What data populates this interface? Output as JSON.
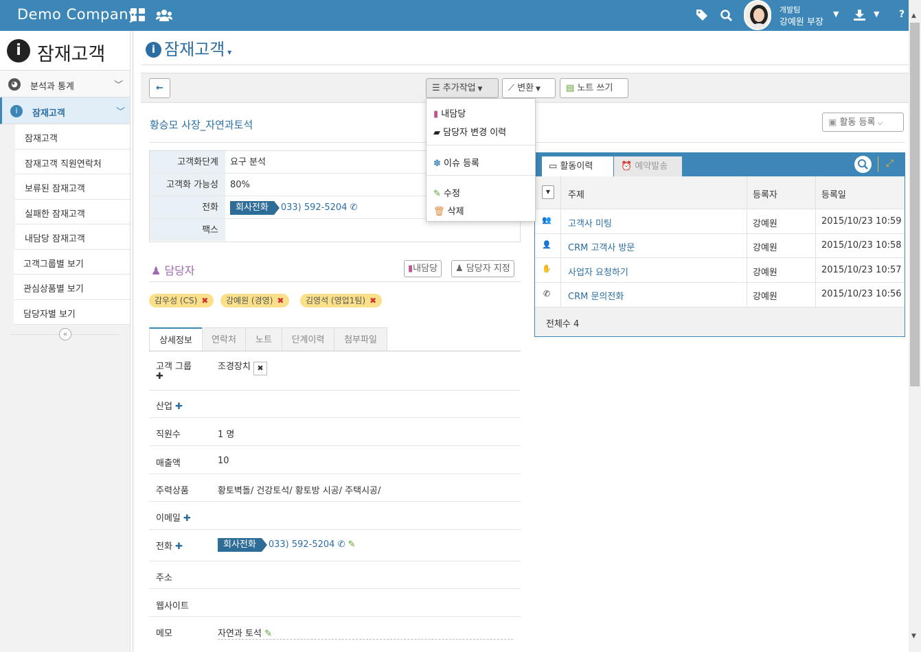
{
  "header": {
    "brand": "Demo Company",
    "user_team": "개발팀",
    "user_name": "강예원 부장",
    "help": "?"
  },
  "sidebar": {
    "title": "잠재고객",
    "items": [
      {
        "label": "분석과 통계"
      },
      {
        "label": "잠재고객"
      }
    ],
    "subitems": [
      "잠재고객",
      "잠재고객 직원연락처",
      "보류된 잠재고객",
      "실패한 잠재고객",
      "내담당 잠재고객",
      "고객그룹별 보기",
      "관심상품별 보기",
      "담당자별 보기"
    ],
    "collapse": "«"
  },
  "page": {
    "title": "잠재고객"
  },
  "toolbar": {
    "back": "←",
    "extra": "추가작업",
    "convert": "변환",
    "note": "노트 쓰기"
  },
  "dropdown": {
    "items": [
      "내담당",
      "담당자 변경 이력",
      "이슈 등록",
      "수정",
      "삭제"
    ]
  },
  "record": {
    "name": "황승모 사장_자연과토석",
    "activity_button": "활동 등록"
  },
  "fields": [
    {
      "label": "고객화단계",
      "value": "요구 분석"
    },
    {
      "label": "고객화 가능성",
      "value": "80%"
    },
    {
      "label": "전화",
      "tag": "회사전화",
      "value": "033) 592-5204"
    },
    {
      "label": "팩스",
      "value": ""
    }
  ],
  "managers": {
    "title": "담당자",
    "mine_button": "내담당",
    "assign_button": "담당자 지정",
    "chips": [
      "감우성 (CS)",
      "강예원 (경영)",
      "김영석 (영업1팀)"
    ]
  },
  "tabs": [
    "상세정보",
    "연락처",
    "노트",
    "단계이력",
    "첨부파일"
  ],
  "details": [
    {
      "label": "고객 그룹",
      "value": "조경장치"
    },
    {
      "label": "산업",
      "value": ""
    },
    {
      "label": "직원수",
      "value": "1 명"
    },
    {
      "label": "매출액",
      "value": "10"
    },
    {
      "label": "주력상품",
      "value": "황토벽돌/ 건강토석/ 황토방 시공/ 주택시공/"
    },
    {
      "label": "이메일",
      "value": ""
    },
    {
      "label": "전화",
      "tag": "회사전화",
      "value": "033) 592-5204"
    },
    {
      "label": "주소",
      "value": ""
    },
    {
      "label": "웹사이트",
      "value": ""
    },
    {
      "label": "메모",
      "value": "자연과 토석"
    }
  ],
  "activity": {
    "tabs": [
      "활동이력",
      "예약발송"
    ],
    "columns": [
      "주제",
      "등록자",
      "등록일"
    ],
    "rows": [
      {
        "subject": "고객사 미팅",
        "by": "강예원",
        "date": "2015/10/23 10:59"
      },
      {
        "subject": "CRM 고객사 방문",
        "by": "강예원",
        "date": "2015/10/23 10:58"
      },
      {
        "subject": "사업자 요청하기",
        "by": "강예원",
        "date": "2015/10/23 10:57"
      },
      {
        "subject": "CRM 문의전화",
        "by": "강예원",
        "date": "2015/10/23 10:56"
      }
    ],
    "total": "전체수 4"
  }
}
